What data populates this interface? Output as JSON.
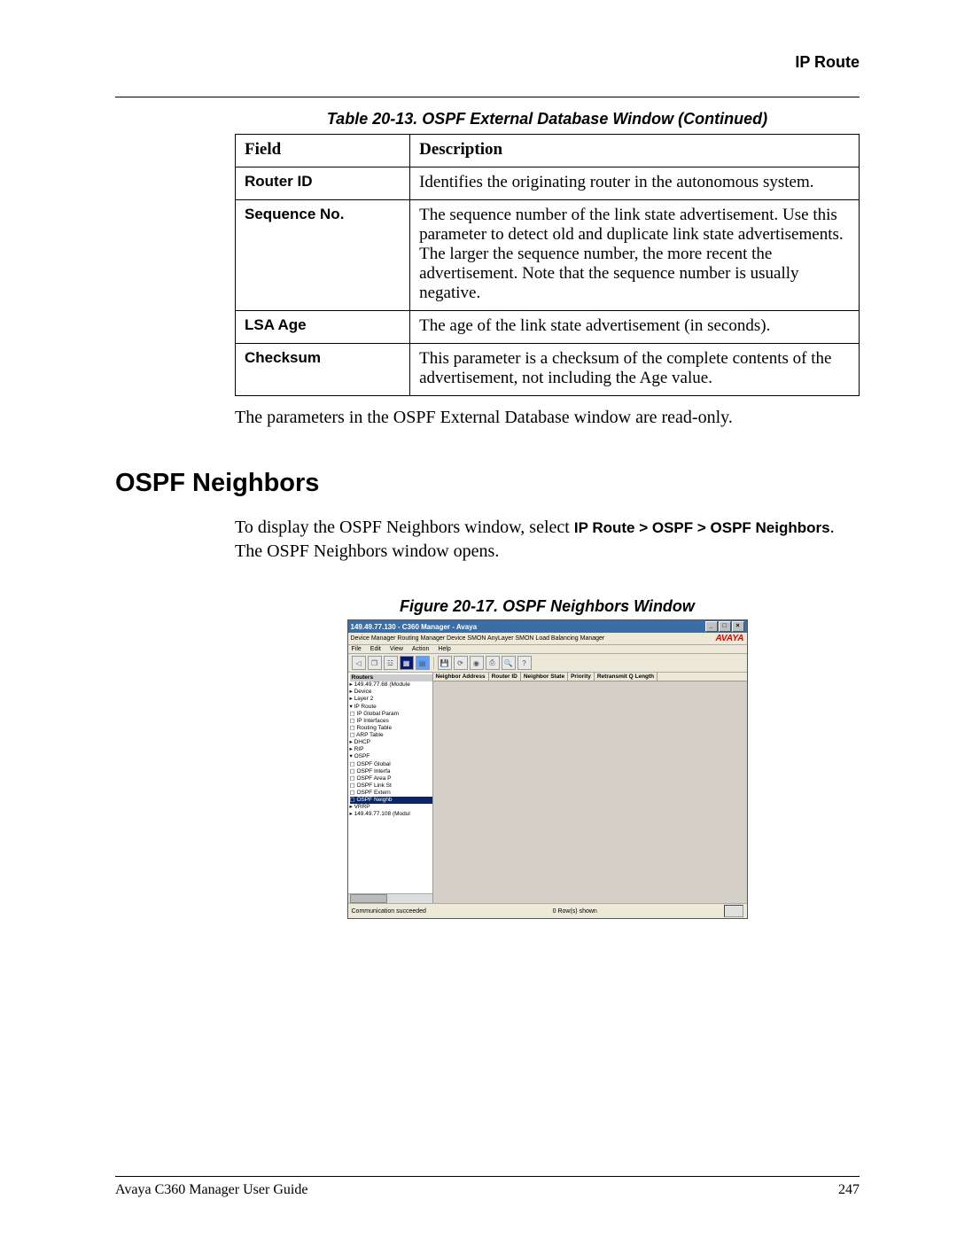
{
  "header": {
    "section": "IP Route"
  },
  "table": {
    "caption": "Table 20-13.  OSPF External Database Window  (Continued)",
    "head_field": "Field",
    "head_desc": "Description",
    "rows": [
      {
        "field": "Router ID",
        "desc": "Identifies the originating router in the autonomous system."
      },
      {
        "field": "Sequence No.",
        "desc": "The sequence number of the link state advertisement. Use this parameter to detect old and duplicate link state advertisements. The larger the sequence number, the more recent the advertisement. Note that the sequence number is usually negative."
      },
      {
        "field": "LSA Age",
        "desc": "The age of the link state advertisement (in seconds)."
      },
      {
        "field": "Checksum",
        "desc": "This parameter is a checksum of the complete contents of the advertisement, not including the Age value."
      }
    ]
  },
  "para_table_note": "The parameters in the OSPF External Database window are read-only.",
  "section_heading": "OSPF Neighbors",
  "body": {
    "pre": "To display the OSPF Neighbors window, select ",
    "crumb": "IP Route > OSPF > OSPF Neighbors",
    "post": ". The OSPF Neighbors window opens."
  },
  "figure_caption": "Figure 20-17.  OSPF Neighbors Window",
  "shot": {
    "title": "149.49.77.130 - C360 Manager - Avaya",
    "subbar": "Device Manager  Routing Manager  Device SMON  AnyLayer SMON  Load Balancing Manager",
    "brand": "AVAYA",
    "menu": [
      "File",
      "Edit",
      "View",
      "Action",
      "Help"
    ],
    "tree_header": "Routers",
    "tree": [
      "▸ 149.49.77.68 (Module",
      "  ▸ Device",
      "  ▸ Layer 2",
      "  ▾ IP Route",
      "    ▢ IP Global Param",
      "    ▢ IP Interfaces",
      "    ▢ Routing Table",
      "    ▢ ARP Table",
      "    ▸ DHCP",
      "    ▸ RIP",
      "    ▾ OSPF",
      "      ▢ OSPF Global",
      "      ▢ OSPF Interfa",
      "      ▢ OSPF Area P",
      "      ▢ OSPF Link St",
      "      ▢ OSPF Extern",
      "      ▢ OSPF Neighb",
      "    ▸ VRRP",
      "▸ 149.49.77.108 (Modul"
    ],
    "tree_selected_index": 16,
    "grid_headers": [
      "Neighbor Address",
      "Router ID",
      "Neighbor State",
      "Priority",
      "Retransmit Q Length"
    ],
    "status_left": "Communication succeeded",
    "status_mid": "0 Row(s) shown"
  },
  "footer": {
    "left": "Avaya C360 Manager User Guide",
    "right": "247"
  }
}
